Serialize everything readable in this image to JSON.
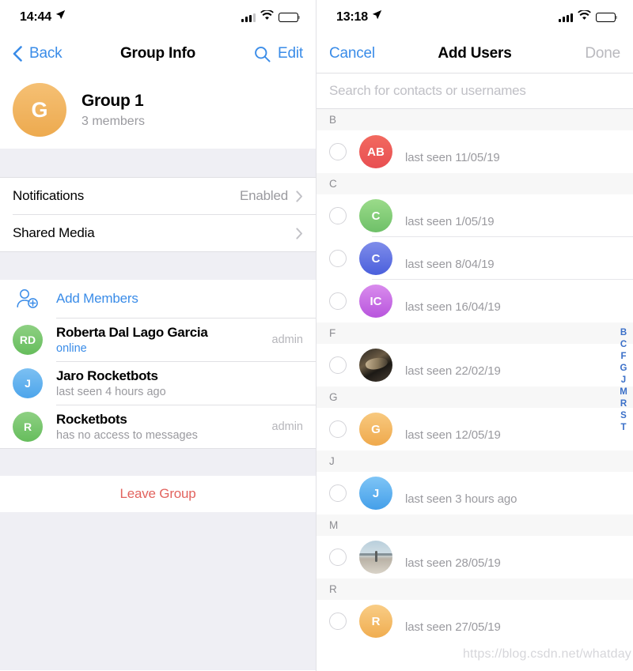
{
  "left": {
    "status": {
      "time": "14:44",
      "location_icon": "location-arrow-icon",
      "signal_bars": 3,
      "battery_level": 55
    },
    "nav": {
      "back_label": "Back",
      "title": "Group Info",
      "search_icon": "search-icon",
      "edit_label": "Edit"
    },
    "group": {
      "avatar_letter": "G",
      "avatar_color": "#f0b45f",
      "name": "Group 1",
      "members_count": "3 members"
    },
    "settings": [
      {
        "label": "Notifications",
        "value": "Enabled"
      },
      {
        "label": "Shared Media",
        "value": ""
      }
    ],
    "add_members_label": "Add Members",
    "members": [
      {
        "initials": "RD",
        "color": "#72c467",
        "name": "Roberta Dal Lago Garcia",
        "status": "online",
        "online": true,
        "role": "admin"
      },
      {
        "initials": "J",
        "color": "#62b0ed",
        "name": "Jaro Rocketbots",
        "status": "last seen 4 hours ago",
        "online": false,
        "role": ""
      },
      {
        "initials": "R",
        "color": "#72c467",
        "name": "Rocketbots",
        "status": "has no access to messages",
        "online": false,
        "role": "admin"
      }
    ],
    "leave_label": "Leave Group"
  },
  "right": {
    "status": {
      "time": "13:18",
      "location_icon": "location-arrow-icon",
      "signal_bars": 4,
      "battery_level": 55
    },
    "nav": {
      "cancel_label": "Cancel",
      "title": "Add Users",
      "done_label": "Done"
    },
    "search": {
      "value": "",
      "placeholder": "Search for contacts or usernames"
    },
    "sections": [
      {
        "letter": "B",
        "contacts": [
          {
            "type": "initials",
            "initials": "AB",
            "color": "#ef5a55",
            "color2": "#f07a6a",
            "name": "",
            "seen": "last seen 11/05/19",
            "checked": false
          }
        ]
      },
      {
        "letter": "C",
        "contacts": [
          {
            "type": "initials",
            "initials": "C",
            "color": "#7bc96f",
            "color2": "#97d685",
            "name": "",
            "seen": "last seen 1/05/19",
            "checked": false
          },
          {
            "type": "initials",
            "initials": "C",
            "color": "#5168e0",
            "color2": "#7b87ea",
            "name": "",
            "seen": "last seen 8/04/19",
            "checked": false
          },
          {
            "type": "initials",
            "initials": "IC",
            "color": "#c061e0",
            "color2": "#d487e8",
            "name": "",
            "seen": "last seen 16/04/19",
            "checked": false
          }
        ]
      },
      {
        "letter": "F",
        "contacts": [
          {
            "type": "photo-dark",
            "initials": "",
            "color": "",
            "color2": "",
            "name": "",
            "seen": "last seen 22/02/19",
            "checked": false
          }
        ]
      },
      {
        "letter": "G",
        "contacts": [
          {
            "type": "initials",
            "initials": "G",
            "color": "#f2b257",
            "color2": "#f7c97f",
            "name": "",
            "seen": "last seen 12/05/19",
            "checked": false
          }
        ]
      },
      {
        "letter": "J",
        "contacts": [
          {
            "type": "initials",
            "initials": "J",
            "color": "#52a9ef",
            "color2": "#78c0f5",
            "name": "",
            "seen": "last seen 3 hours ago",
            "checked": false
          }
        ]
      },
      {
        "letter": "M",
        "contacts": [
          {
            "type": "photo-beach",
            "initials": "",
            "color": "",
            "color2": "",
            "name": "",
            "seen": "last seen 28/05/19",
            "checked": false
          }
        ]
      },
      {
        "letter": "R",
        "contacts": [
          {
            "type": "initials",
            "initials": "R",
            "color": "#f2b257",
            "color2": "#f8ca83",
            "name": "",
            "seen": "last seen 27/05/19",
            "checked": false
          }
        ]
      }
    ],
    "index_letters": [
      "B",
      "C",
      "F",
      "G",
      "J",
      "M",
      "R",
      "S",
      "T"
    ]
  },
  "watermark": "https://blog.csdn.net/whatday",
  "colors": {
    "accent": "#3a8ce8",
    "destructive": "#e2635e",
    "group_bg": "#efeff4",
    "index": "#3a6fc8"
  }
}
